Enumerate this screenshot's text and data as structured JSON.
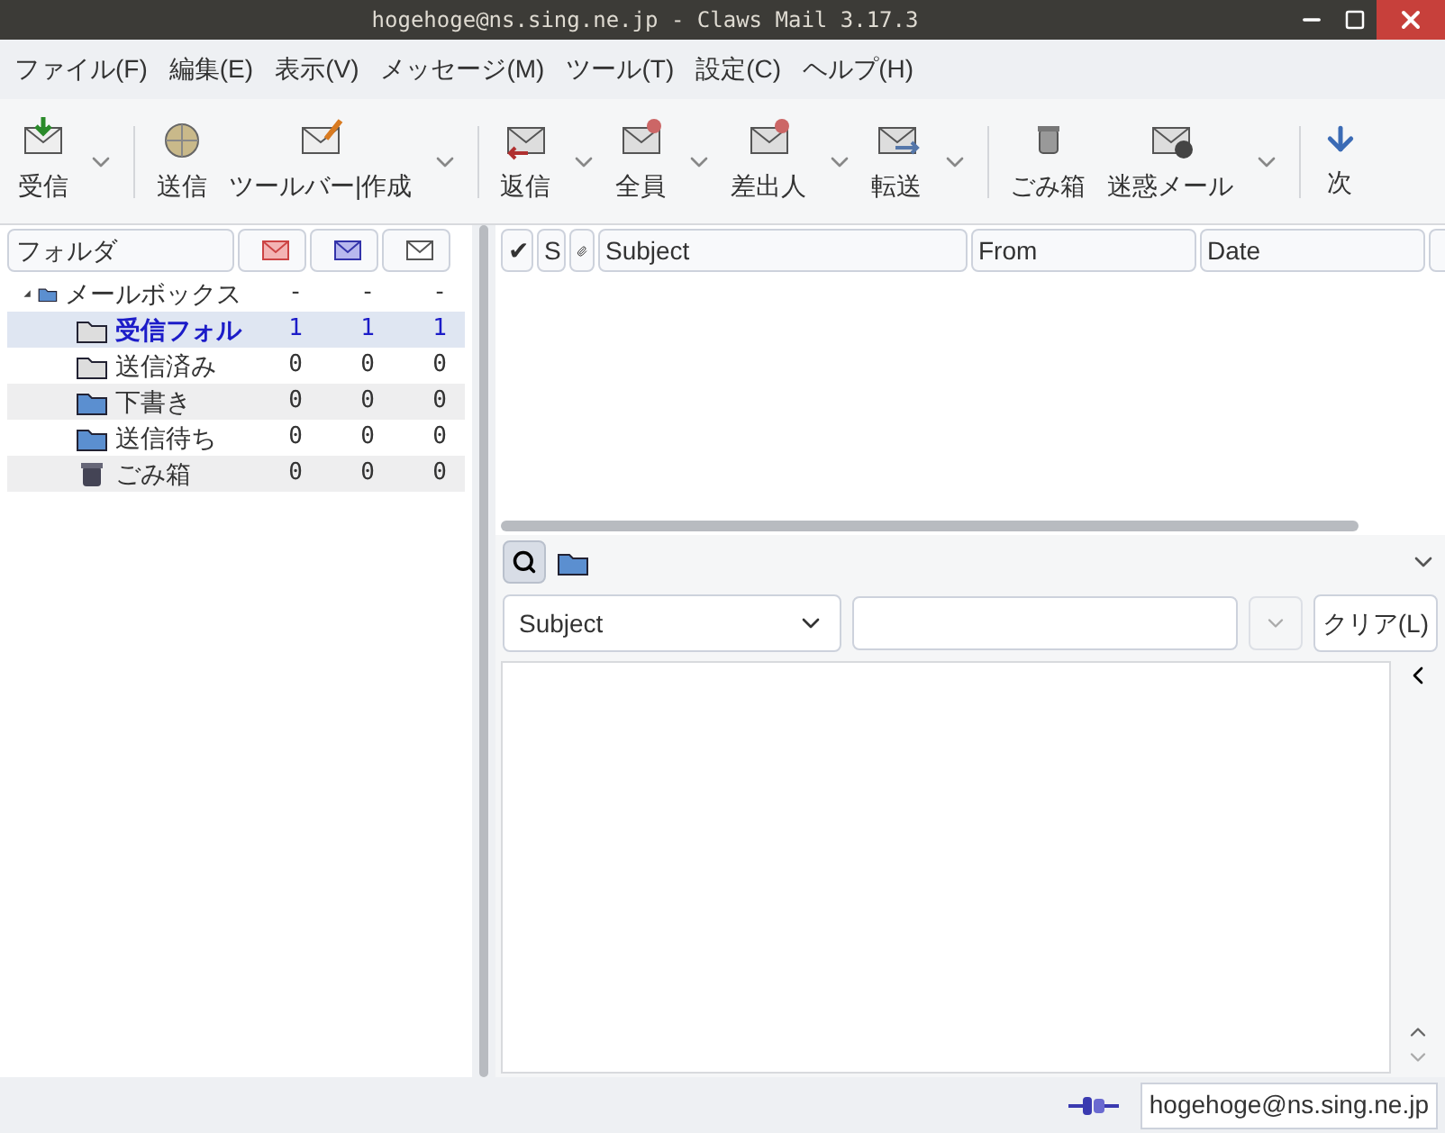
{
  "window": {
    "title": "hogehoge@ns.sing.ne.jp - Claws Mail 3.17.3"
  },
  "menu": [
    "ファイル(F)",
    "編集(E)",
    "表示(V)",
    "メッセージ(M)",
    "ツール(T)",
    "設定(C)",
    "ヘルプ(H)"
  ],
  "toolbar": {
    "groups": [
      [
        {
          "label": "受信",
          "has_menu": true
        }
      ],
      [
        {
          "label": "送信",
          "has_menu": false
        },
        {
          "label": "ツールバー|作成",
          "has_menu": true
        }
      ],
      [
        {
          "label": "返信",
          "has_menu": true
        },
        {
          "label": "全員",
          "has_menu": true
        },
        {
          "label": "差出人",
          "has_menu": true
        },
        {
          "label": "転送",
          "has_menu": true
        }
      ],
      [
        {
          "label": "ごみ箱",
          "has_menu": false
        },
        {
          "label": "迷惑メール",
          "has_menu": true
        }
      ],
      [
        {
          "label": "次",
          "has_menu": false
        }
      ]
    ]
  },
  "folder_pane": {
    "columns": [
      {
        "label": "フォルダ",
        "kind": "text"
      },
      {
        "kind": "unread"
      },
      {
        "kind": "new"
      },
      {
        "kind": "total"
      }
    ],
    "folders": [
      {
        "name": "メールボックス",
        "expanded": true,
        "selected": false,
        "counts": [
          "-",
          "-",
          "-"
        ],
        "children": [
          {
            "name": "受信フォル",
            "selected": true,
            "counts": [
              "1",
              "1",
              "1"
            ]
          },
          {
            "name": "送信済み",
            "selected": false,
            "counts": [
              "0",
              "0",
              "0"
            ]
          },
          {
            "name": "下書き",
            "selected": false,
            "counts": [
              "0",
              "0",
              "0"
            ]
          },
          {
            "name": "送信待ち",
            "selected": false,
            "counts": [
              "0",
              "0",
              "0"
            ]
          },
          {
            "name": "ごみ箱",
            "selected": false,
            "counts": [
              "0",
              "0",
              "0"
            ]
          }
        ]
      }
    ]
  },
  "message_list": {
    "columns": [
      {
        "kind": "text",
        "label": "✔"
      },
      {
        "kind": "text",
        "label": "S"
      },
      {
        "kind": "attachment"
      },
      {
        "kind": "text",
        "label": "Subject"
      },
      {
        "kind": "text",
        "label": "From"
      },
      {
        "kind": "text",
        "label": "Date"
      }
    ]
  },
  "search": {
    "toggle_selected": true,
    "field": "Subject",
    "clear_label": "クリア(L)"
  },
  "status_bar": {
    "account": "hogehoge@ns.sing.ne.jp"
  }
}
